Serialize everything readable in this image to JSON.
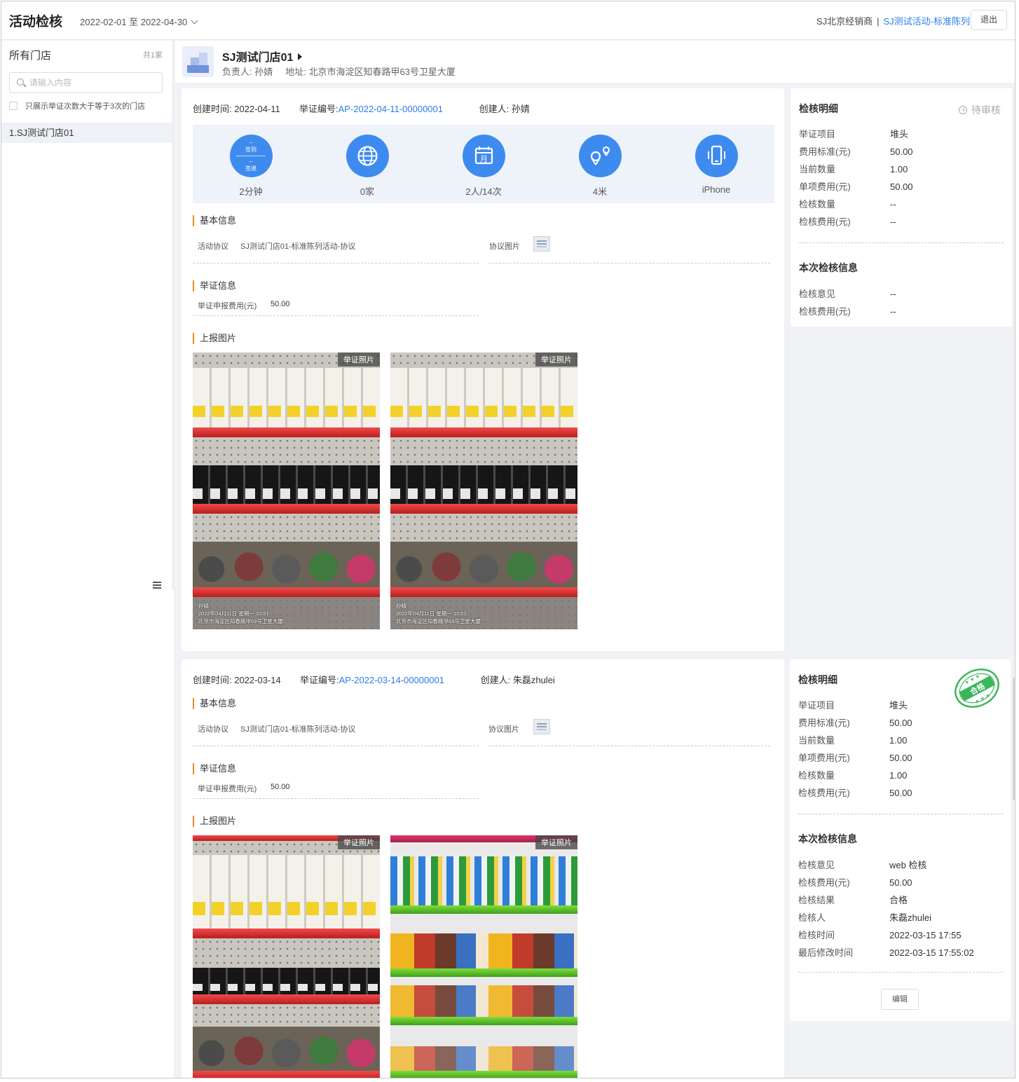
{
  "header": {
    "title": "活动检核",
    "date_range": "2022-02-01 至 2022-04-30",
    "dealer": "SJ北京经销商",
    "separator": "|",
    "activity": "SJ测试活动-标准陈列",
    "logout": "退出"
  },
  "sidebar": {
    "title": "所有门店",
    "count": "共1家",
    "search_placeholder": "请输入内容",
    "filter_label": "只展示举证次数大于等于3次的门店",
    "items": [
      {
        "label": "1.SJ测试门店01"
      }
    ]
  },
  "store": {
    "name": "SJ测试门店01",
    "owner": "负责人: 孙婧",
    "address": "地址: 北京市海淀区知春路甲63号卫星大厦"
  },
  "records": [
    {
      "created": "创建时间: 2022-04-11",
      "proof_label": "举证编号: ",
      "proof_no": "AP-2022-04-11-00000001",
      "creator": "创建人: 孙婧",
      "stats": {
        "sign_in": "签到",
        "sign_out": "签退",
        "dash": "--",
        "duration": "2分钟",
        "stores": "0家",
        "people": "2人/14次",
        "distance": "4米",
        "device": "iPhone"
      },
      "basic_title": "基本信息",
      "agreement_label": "活动协议",
      "agreement_link": "SJ测试门店01-标准陈列活动-协议",
      "agreement_image_label": "协议图片",
      "proof_title": "举证信息",
      "fee_label": "举证申报费用(元)",
      "fee_value": "50.00",
      "photos_title": "上报图片",
      "photo_tag": "举证照片",
      "watermark_name": "孙婧",
      "watermark_time": "2022年04月11日 星期一 10:51",
      "watermark_addr": "北京市海淀区知春路甲63号卫星大厦"
    },
    {
      "created": "创建时间: 2022-03-14",
      "proof_label": "举证编号: ",
      "proof_no": "AP-2022-03-14-00000001",
      "creator": "创建人: 朱磊zhulei",
      "basic_title": "基本信息",
      "agreement_label": "活动协议",
      "agreement_link": "SJ测试门店01-标准陈列活动-协议",
      "agreement_image_label": "协议图片",
      "proof_title": "举证信息",
      "fee_label": "举证申报费用(元)",
      "fee_value": "50.00",
      "photos_title": "上报图片",
      "photo_tag": "举证照片"
    }
  ],
  "details": [
    {
      "title": "检核明细",
      "status": "待审核",
      "rows": [
        {
          "k": "举证项目",
          "v": "堆头"
        },
        {
          "k": "费用标准(元)",
          "v": "50.00"
        },
        {
          "k": "当前数量",
          "v": "1.00"
        },
        {
          "k": "单项费用(元)",
          "v": "50.00"
        },
        {
          "k": "检核数量",
          "v": "--"
        },
        {
          "k": "检核费用(元)",
          "v": "--"
        }
      ],
      "section_title": "本次检核信息",
      "info_rows": [
        {
          "k": "检核意见",
          "v": "--"
        },
        {
          "k": "检核费用(元)",
          "v": "--"
        }
      ]
    },
    {
      "title": "检核明细",
      "stamp": "合格",
      "rows": [
        {
          "k": "举证项目",
          "v": "堆头"
        },
        {
          "k": "费用标准(元)",
          "v": "50.00"
        },
        {
          "k": "当前数量",
          "v": "1.00"
        },
        {
          "k": "单项费用(元)",
          "v": "50.00"
        },
        {
          "k": "检核数量",
          "v": "1.00"
        },
        {
          "k": "检核费用(元)",
          "v": "50.00"
        }
      ],
      "section_title": "本次检核信息",
      "info_rows": [
        {
          "k": "检核意见",
          "v": "web 检核"
        },
        {
          "k": "检核费用(元)",
          "v": "50.00"
        },
        {
          "k": "检核结果",
          "v": "合格"
        },
        {
          "k": "检核人",
          "v": "朱磊zhulei"
        },
        {
          "k": "检核时间",
          "v": "2022-03-15 17:55"
        },
        {
          "k": "最后修改时间",
          "v": "2022-03-15 17:55:02"
        }
      ],
      "edit": "编辑"
    }
  ],
  "colors": {
    "accent": "#2b7de9",
    "stat_blue": "#3e8bf0",
    "section_bar": "#f08a24",
    "stamp_green": "#3cb65a"
  }
}
